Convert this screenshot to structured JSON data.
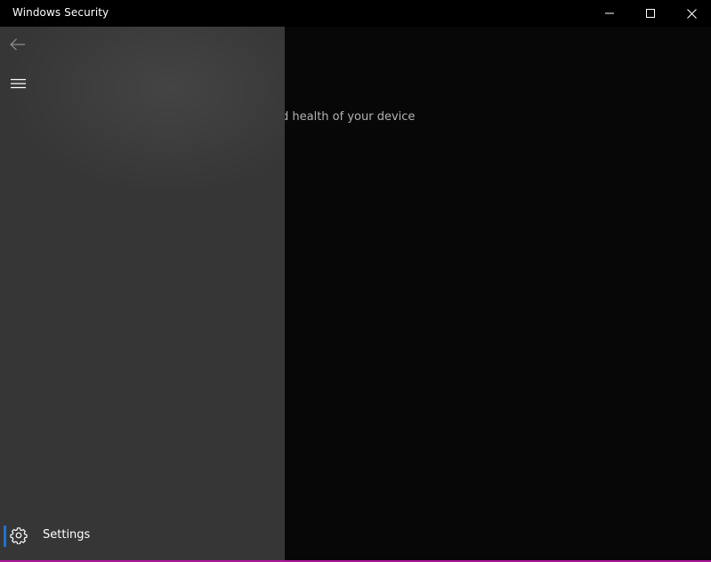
{
  "window": {
    "title": "Windows Security"
  },
  "content": {
    "subtitle_fragment": "d health of your device"
  },
  "nav": {
    "back_icon": "back-arrow-icon",
    "menu_icon": "hamburger-icon",
    "settings_label": "Settings",
    "settings_icon": "gear-icon"
  },
  "colors": {
    "titlebar_bg": "#000000",
    "nav_bg": "#363636",
    "content_bg": "#070707",
    "accent": "#1a73d9",
    "window_border": "#b0189a"
  }
}
